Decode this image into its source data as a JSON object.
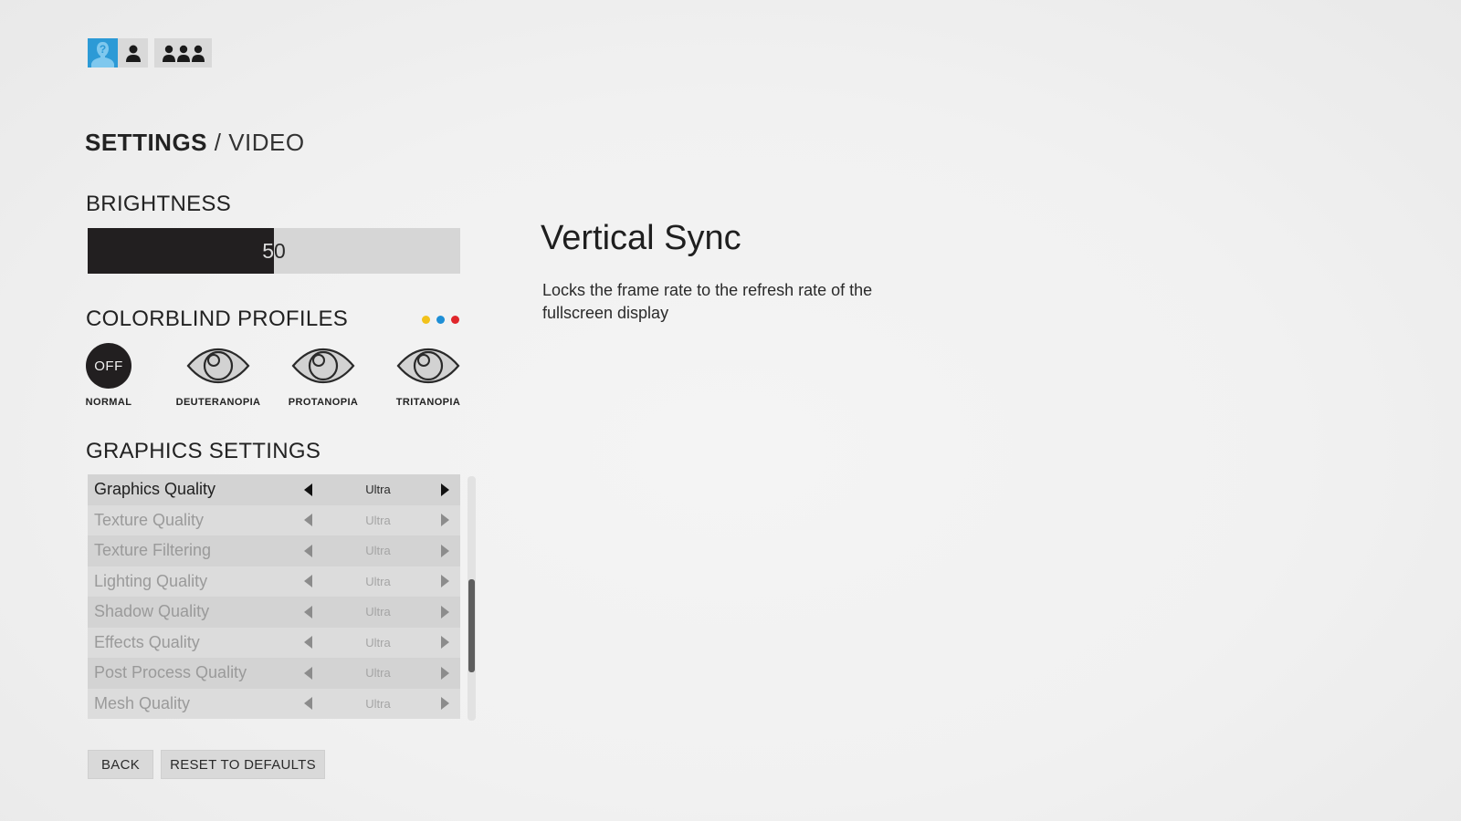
{
  "profile_tabs": [
    {
      "name": "guest-profile",
      "icon": "unknown-user-icon",
      "active": true
    },
    {
      "name": "single-player",
      "icon": "user-icon",
      "active": false
    },
    {
      "name": "multiplayer",
      "icon": "group-icon",
      "active": false
    }
  ],
  "header": {
    "title": "SETTINGS",
    "separator": "/",
    "subtitle": "VIDEO"
  },
  "brightness": {
    "label": "BRIGHTNESS",
    "value": "50",
    "min": 0,
    "max": 100,
    "fraction": 0.5
  },
  "colorblind": {
    "label": "COLORBLIND PROFILES",
    "dot_colors": [
      "#f2c21b",
      "#1e8fd6",
      "#e0262b"
    ],
    "selected": "NORMAL",
    "profiles": [
      {
        "id": "normal",
        "label": "NORMAL",
        "icon": "off-icon",
        "icon_text": "OFF"
      },
      {
        "id": "deuteranopia",
        "label": "DEUTERANOPIA",
        "icon": "eye-icon"
      },
      {
        "id": "protanopia",
        "label": "PROTANOPIA",
        "icon": "eye-icon"
      },
      {
        "id": "tritanopia",
        "label": "TRITANOPIA",
        "icon": "eye-icon"
      }
    ]
  },
  "graphics": {
    "label": "GRAPHICS SETTINGS",
    "rows": [
      {
        "name": "Graphics Quality",
        "value": "Ultra",
        "selected": true
      },
      {
        "name": "Texture Quality",
        "value": "Ultra",
        "selected": false
      },
      {
        "name": "Texture Filtering",
        "value": "Ultra",
        "selected": false
      },
      {
        "name": "Lighting Quality",
        "value": "Ultra",
        "selected": false
      },
      {
        "name": "Shadow Quality",
        "value": "Ultra",
        "selected": false
      },
      {
        "name": "Effects Quality",
        "value": "Ultra",
        "selected": false
      },
      {
        "name": "Post Process Quality",
        "value": "Ultra",
        "selected": false
      },
      {
        "name": "Mesh Quality",
        "value": "Ultra",
        "selected": false
      }
    ],
    "scroll": {
      "position_fraction": 0.42,
      "visible_fraction": 0.38
    }
  },
  "buttons": {
    "back": "BACK",
    "reset": "RESET TO DEFAULTS"
  },
  "description": {
    "title": "Vertical Sync",
    "body": "Locks the frame rate to the refresh rate of the fullscreen display"
  },
  "colors": {
    "accent": "#2c9ad6",
    "dark": "#221f20",
    "background": "#f1f1f1"
  }
}
